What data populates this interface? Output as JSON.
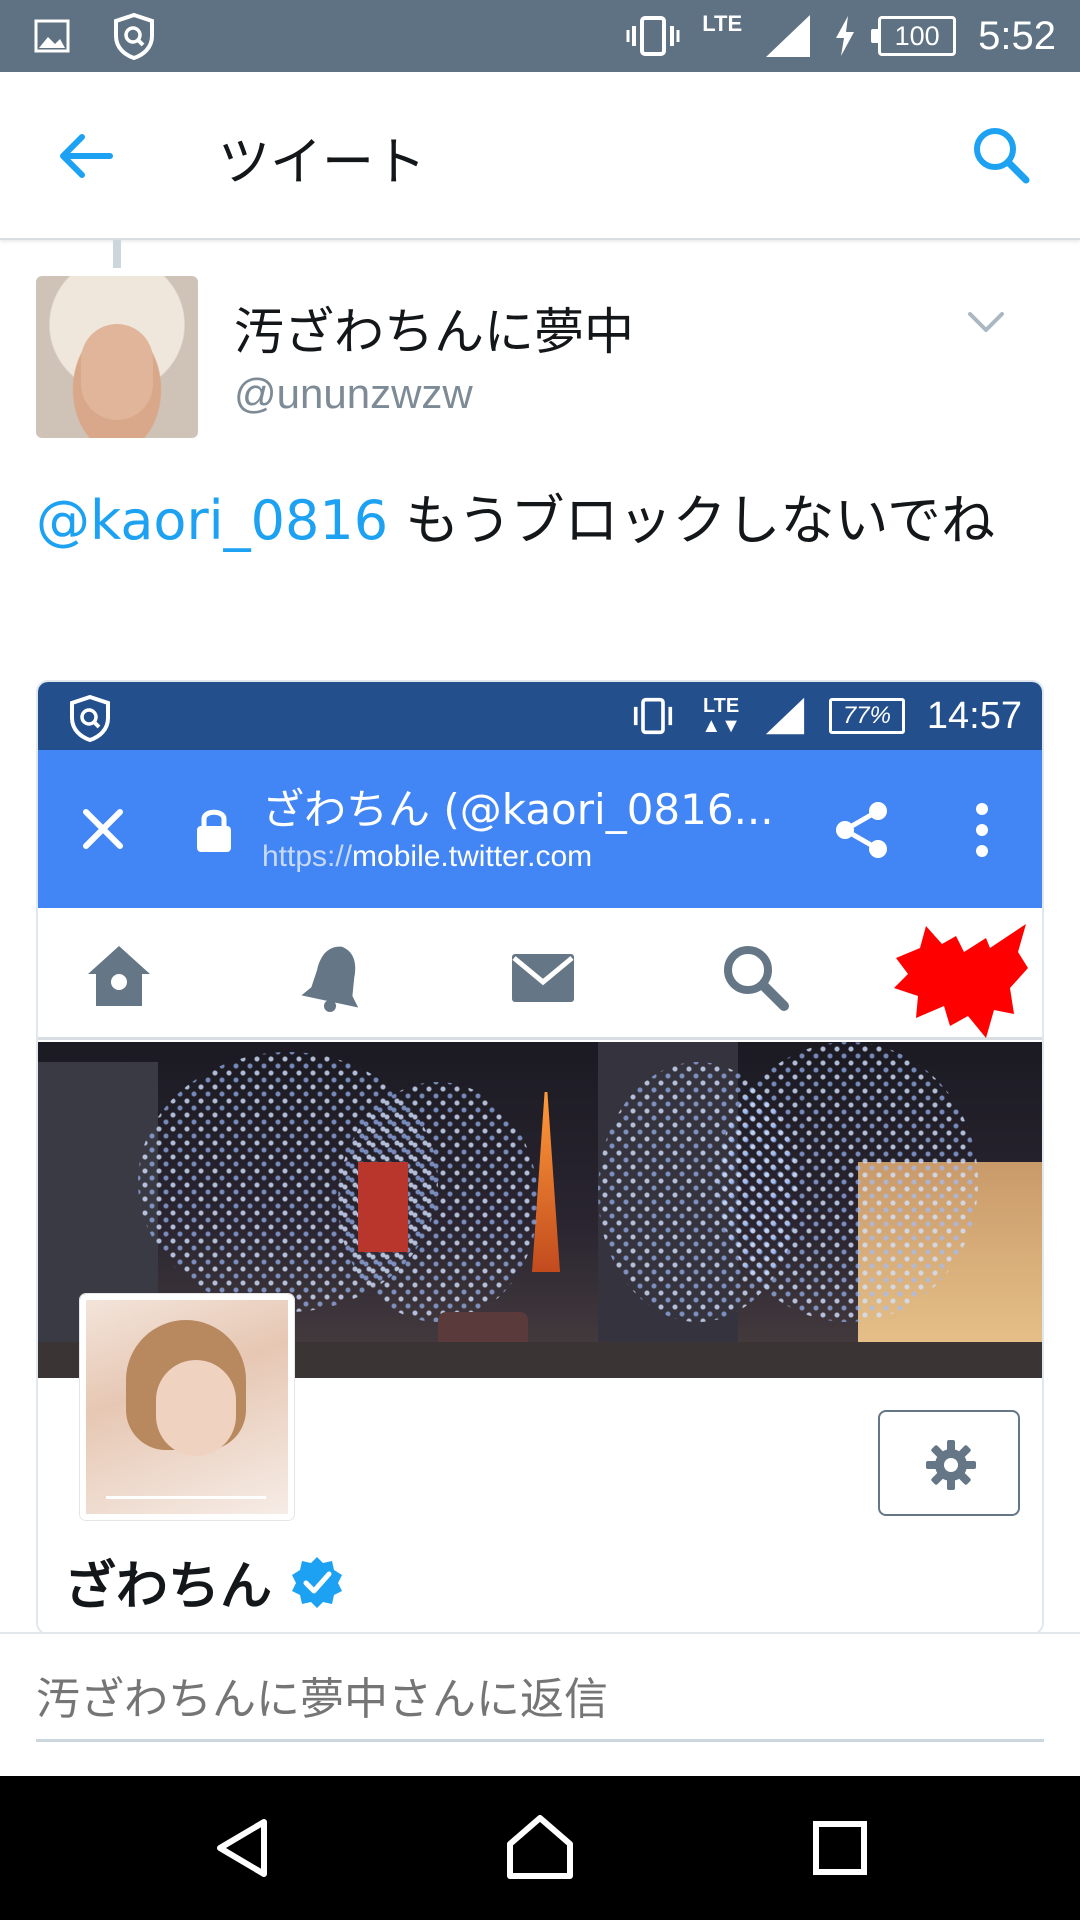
{
  "status_bar": {
    "network": "LTE",
    "battery": "100",
    "time": "5:52"
  },
  "app_bar": {
    "title": "ツイート"
  },
  "tweet": {
    "display_name": "汚ざわちんに夢中",
    "handle": "@ununzwzw",
    "mention": "@kaori_0816",
    "text": " もうブロックしないでね"
  },
  "embedded_screenshot": {
    "status_bar": {
      "network": "LTE",
      "battery": "77%",
      "time": "14:57"
    },
    "toolbar": {
      "page_title": "ざわちん (@kaori_0816...",
      "url_scheme": "https://",
      "url_host": "mobile.twitter.com"
    },
    "profile": {
      "name": "ざわちん"
    }
  },
  "reply": {
    "placeholder": "汚ざわちんに夢中さんに返信"
  },
  "colors": {
    "status_bar_bg": "#5e7283",
    "twitter_blue": "#1da1f2",
    "chrome_blue": "#4285f4",
    "embedded_status_bg": "#234f8d"
  }
}
